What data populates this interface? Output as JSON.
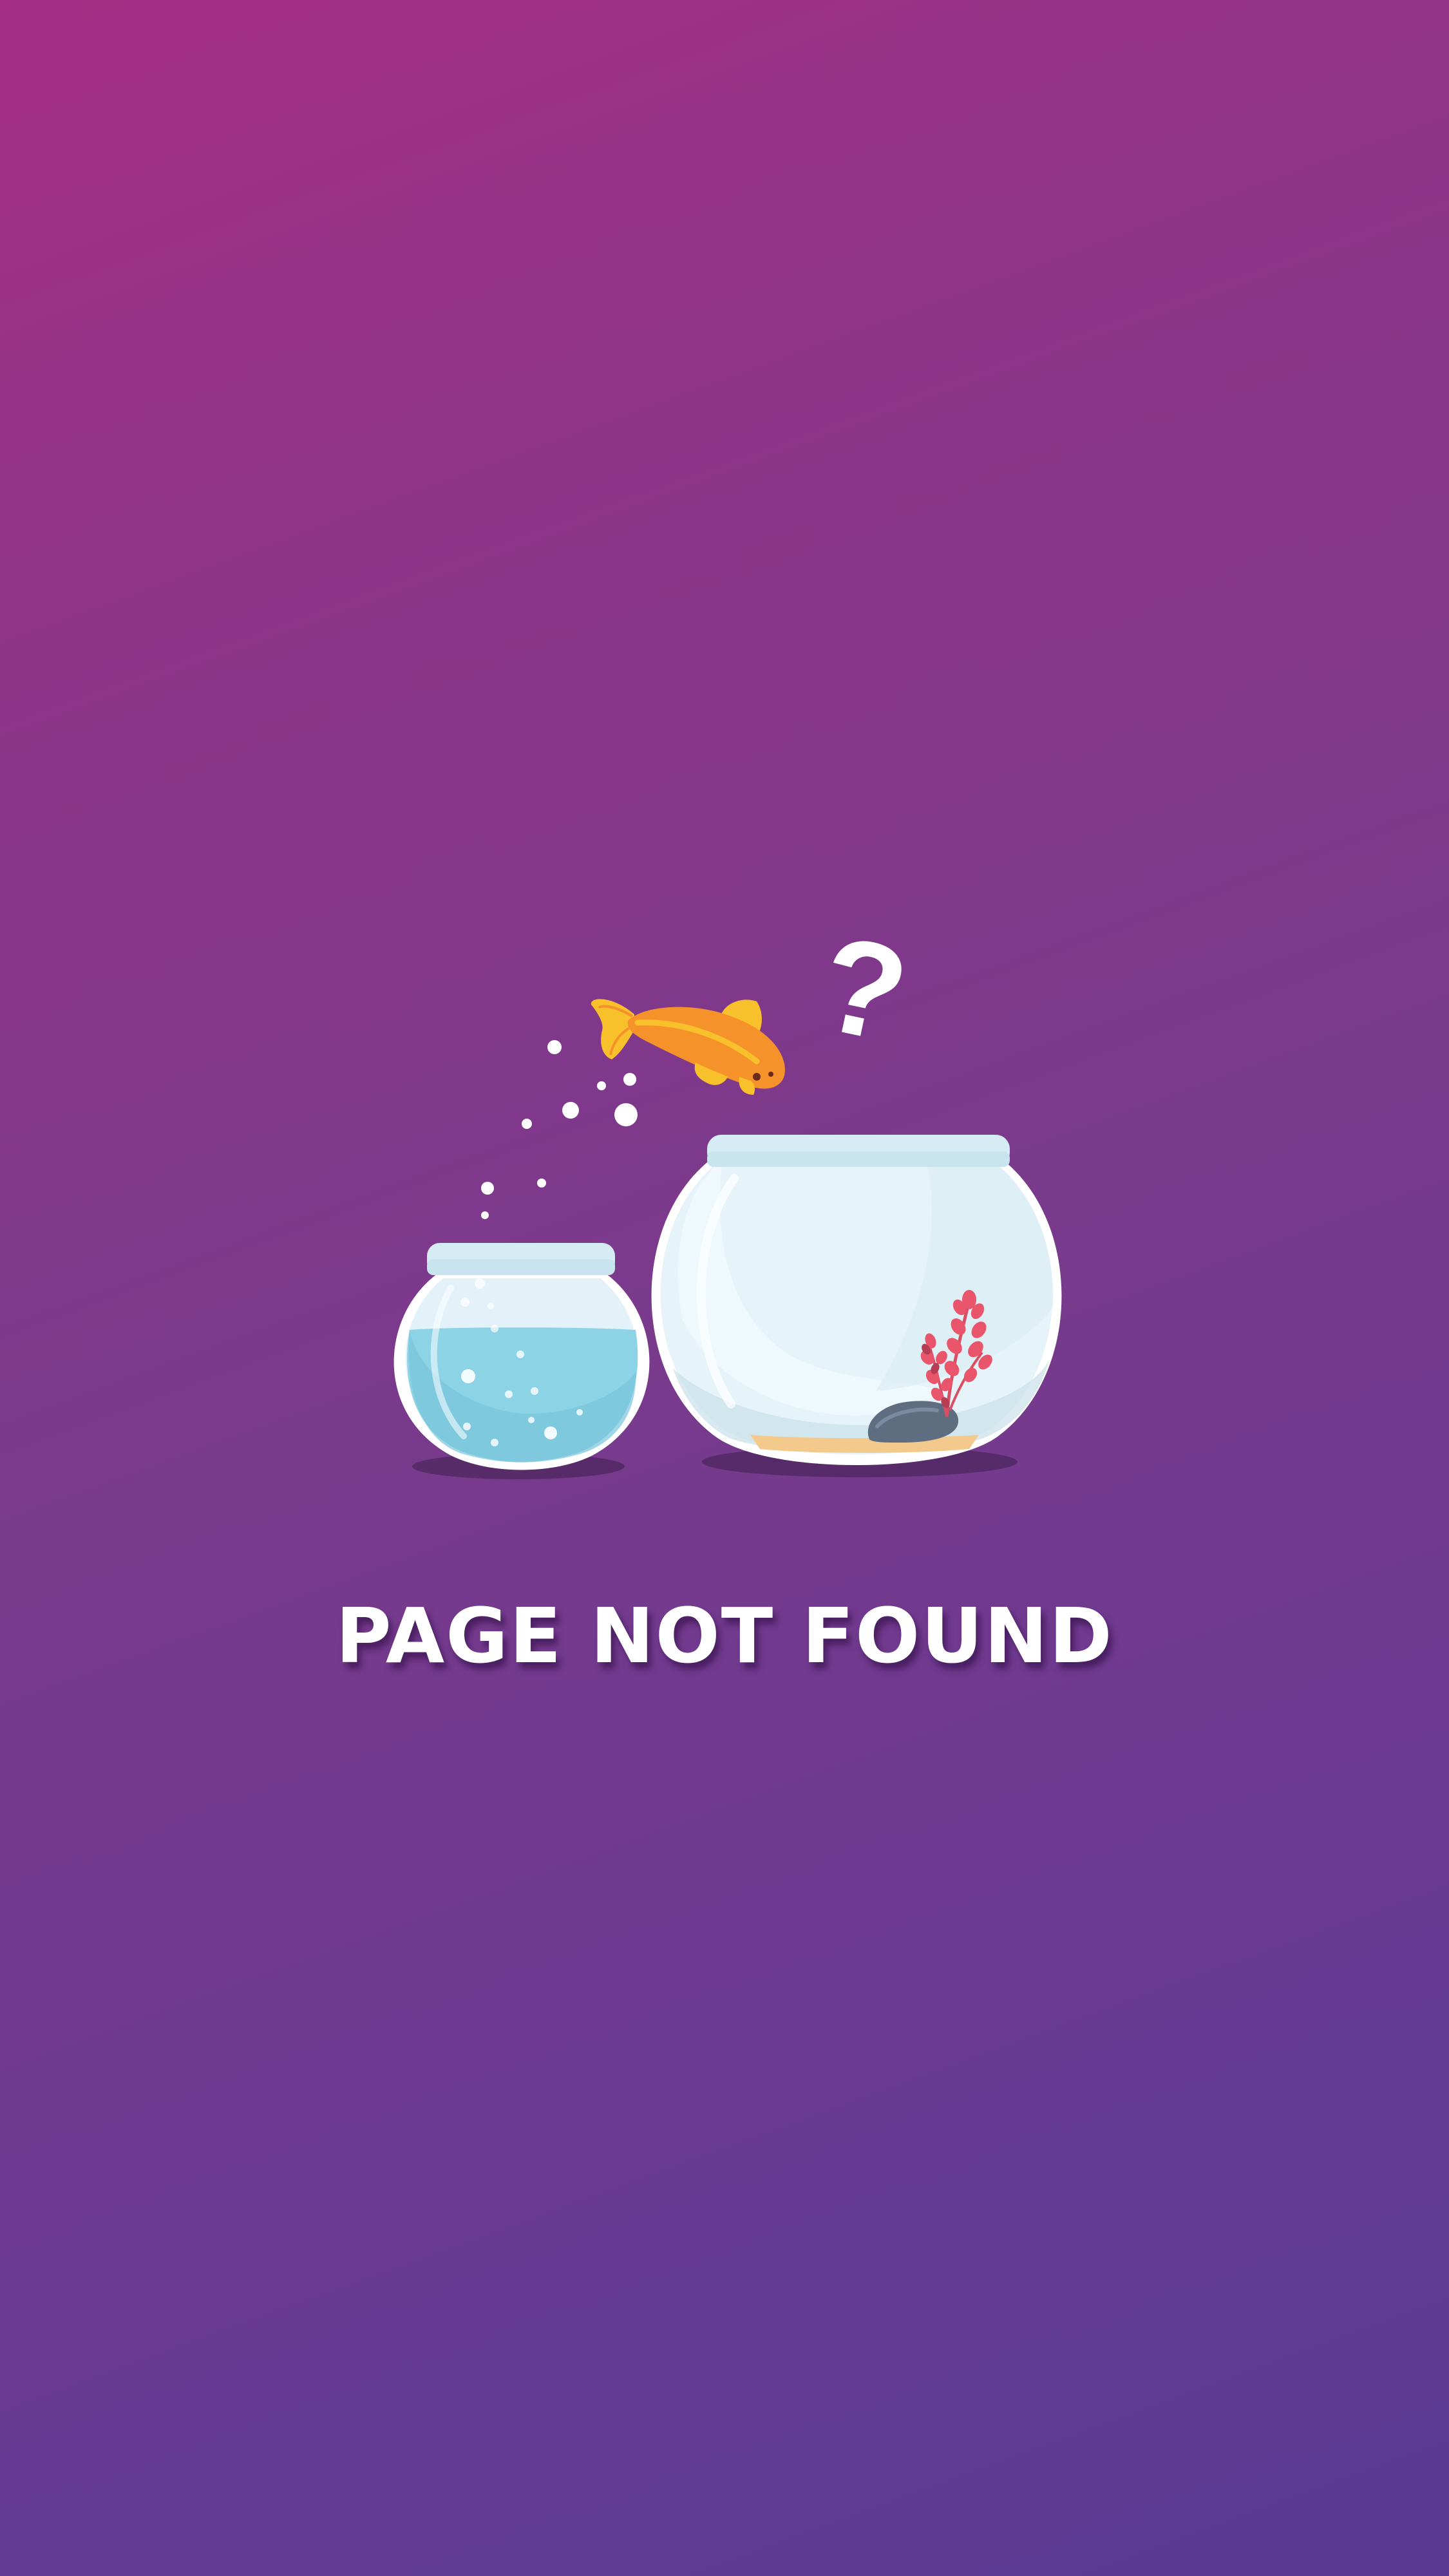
{
  "error_page": {
    "title": "PAGE NOT FOUND",
    "question_mark": "?"
  },
  "colors": {
    "background_top": "#a52f86",
    "background_bottom": "#5a3a94",
    "text": "#ffffff",
    "fish_orange": "#f5922a",
    "fish_yellow": "#f8c02a",
    "water": "#8dd3e6",
    "bowl_glass": "#e8f5fa",
    "rock": "#5e6d80",
    "plant": "#e9566b",
    "sand": "#f3c98c"
  },
  "icons": {
    "fish": "goldfish-icon",
    "question": "question-mark-icon",
    "small_bowl": "small-fishbowl-icon",
    "large_bowl": "large-fishbowl-icon"
  }
}
